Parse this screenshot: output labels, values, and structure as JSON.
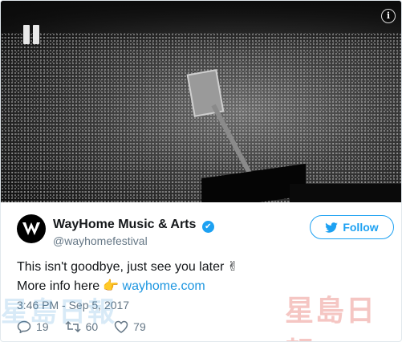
{
  "media": {
    "pause_icon": "pause-icon",
    "info_icon": "info-icon",
    "info_label": "i"
  },
  "user": {
    "name": "WayHome Music & Arts",
    "handle": "@wayhomefestival",
    "verified": true,
    "avatar_icon": "wayhome-logo"
  },
  "follow_button": {
    "label": "Follow",
    "icon": "bird-icon"
  },
  "tweet": {
    "line1": "This isn't goodbye, just see you later",
    "line1_emoji": "✌",
    "line2_prefix": "More info here",
    "line2_emoji": "👉",
    "link_text": "wayhome.com"
  },
  "timestamp": "3:46 PM - Sep 5, 2017",
  "actions": {
    "replies": "19",
    "retweets": "60",
    "likes": "79"
  },
  "watermark": {
    "right_text": "星島日報",
    "left_text": "星島日報"
  },
  "colors": {
    "accent": "#1da1f2",
    "link": "#1b95e0",
    "muted": "#657786"
  }
}
